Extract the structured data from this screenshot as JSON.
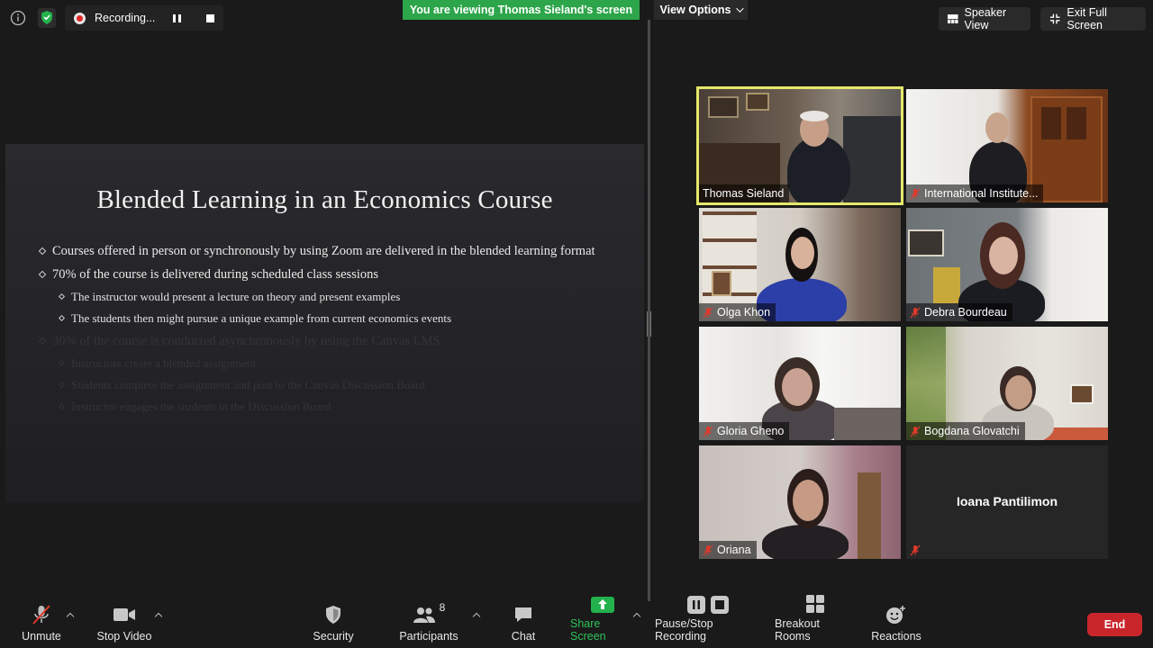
{
  "top_bar": {
    "recording_label": "Recording...",
    "viewing_banner": "You are viewing Thomas Sieland's screen",
    "view_options": "View Options",
    "speaker_view": "Speaker View",
    "exit_full_screen": "Exit Full Screen"
  },
  "slide": {
    "title": "Blended Learning in an Economics Course",
    "bullets": [
      "Courses offered in person or synchronously by using Zoom are delivered in the blended learning format",
      "70% of the course is delivered during scheduled class sessions",
      "The instructor would present a lecture on theory and present examples",
      "The students then might pursue a unique example from current economics events",
      "30% of the course is conducted asynchronously by using the Canvas LMS",
      "Instructors create a blended assignment",
      "Students complete the assignment and post to the Canvas Discussion Board",
      "Instructor engages the students in the Discussion Board"
    ]
  },
  "participants": [
    {
      "name": "Thomas Sieland",
      "muted": false,
      "active": true
    },
    {
      "name": "International Institute...",
      "muted": true
    },
    {
      "name": "Olga Khon",
      "muted": true
    },
    {
      "name": "Debra Bourdeau",
      "muted": true
    },
    {
      "name": "Gloria Gheno",
      "muted": true
    },
    {
      "name": "Bogdana Glovatchi",
      "muted": true
    },
    {
      "name": "Oriana",
      "muted": true
    },
    {
      "name": "Ioana Pantilimon",
      "muted": true,
      "video_off": true
    }
  ],
  "toolbar": {
    "unmute": "Unmute",
    "stop_video": "Stop Video",
    "security": "Security",
    "participants": "Participants",
    "participants_count": "8",
    "chat": "Chat",
    "share_screen": "Share Screen",
    "pause_stop_recording": "Pause/Stop Recording",
    "breakout_rooms": "Breakout Rooms",
    "reactions": "Reactions",
    "end": "End"
  },
  "colors": {
    "banner_green": "#2da54a",
    "active_speaker_border": "#e5e86a",
    "end_red": "#c9262c",
    "mute_red": "#e0392b"
  }
}
